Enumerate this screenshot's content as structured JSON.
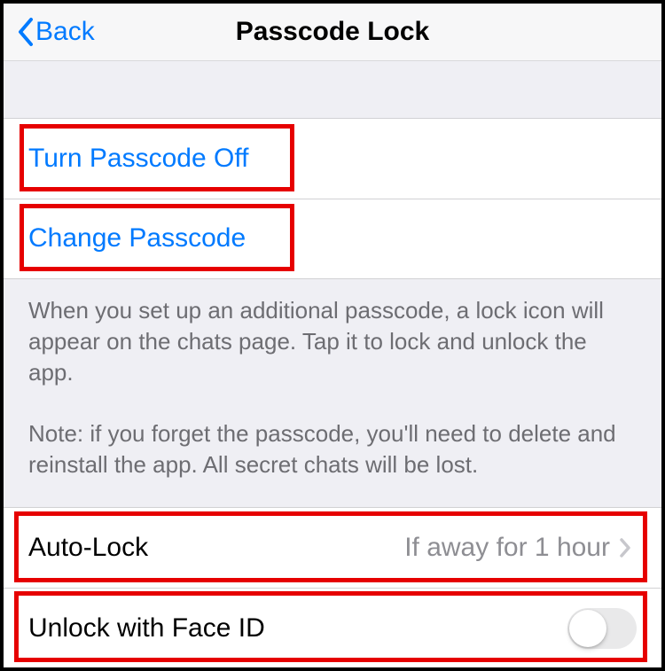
{
  "nav": {
    "back_label": "Back",
    "title": "Passcode Lock"
  },
  "actions": {
    "turn_off": "Turn Passcode Off",
    "change": "Change Passcode"
  },
  "footer": {
    "para1": "When you set up an additional passcode, a lock icon will appear on the chats page. Tap it to lock and unlock the app.",
    "para2": "Note: if you forget the passcode, you'll need to delete and reinstall the app. All secret chats will be lost."
  },
  "autolock": {
    "label": "Auto-Lock",
    "value": "If away for 1 hour"
  },
  "faceid": {
    "label": "Unlock with Face ID",
    "enabled": false
  },
  "colors": {
    "ios_blue": "#007aff",
    "highlight_red": "#e60000",
    "group_bg": "#efeff4"
  }
}
